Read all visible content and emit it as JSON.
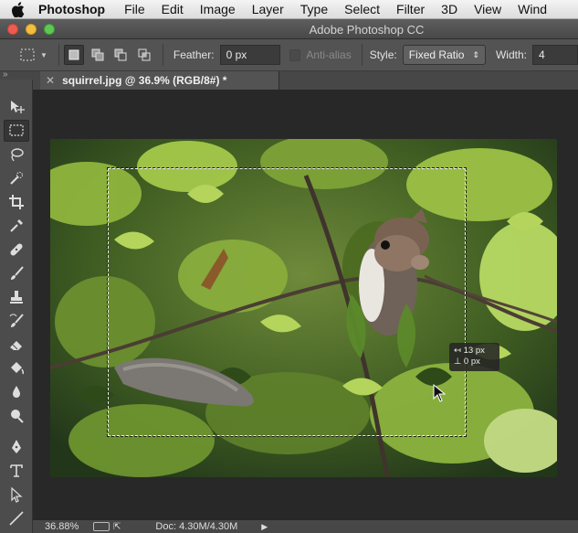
{
  "menu": {
    "apple_icon": "apple-icon",
    "app_name": "Photoshop",
    "items": [
      "File",
      "Edit",
      "Image",
      "Layer",
      "Type",
      "Select",
      "Filter",
      "3D",
      "View",
      "Wind"
    ]
  },
  "window": {
    "title": "Adobe Photoshop CC"
  },
  "options": {
    "feather_label": "Feather:",
    "feather_value": "0 px",
    "antialias_label": "Anti-alias",
    "style_label": "Style:",
    "style_value": "Fixed Ratio",
    "width_label": "Width:",
    "width_value": "4"
  },
  "document": {
    "tab_title": "squirrel.jpg @ 36.9% (RGB/8#) *"
  },
  "hud": {
    "dx": "13 px",
    "dy": "0 px"
  },
  "status": {
    "zoom": "36.88%",
    "doc_info": "Doc: 4.30M/4.30M"
  },
  "tools": [
    "move-tool-icon",
    "rectangular-marquee-tool-icon",
    "lasso-tool-icon",
    "quick-selection-tool-icon",
    "crop-tool-icon",
    "eyedropper-tool-icon",
    "spot-healing-brush-icon",
    "brush-tool-icon",
    "clone-stamp-icon",
    "history-brush-icon",
    "eraser-tool-icon",
    "paint-bucket-icon",
    "blur-tool-icon",
    "dodge-tool-icon",
    "pen-tool-icon",
    "type-tool-icon",
    "path-selection-tool-icon",
    "line-tool-icon"
  ],
  "colors": {
    "menubar": "#e6e6e6",
    "titlebar": "#545454",
    "panel": "#535353",
    "canvas_bg": "#282828"
  }
}
